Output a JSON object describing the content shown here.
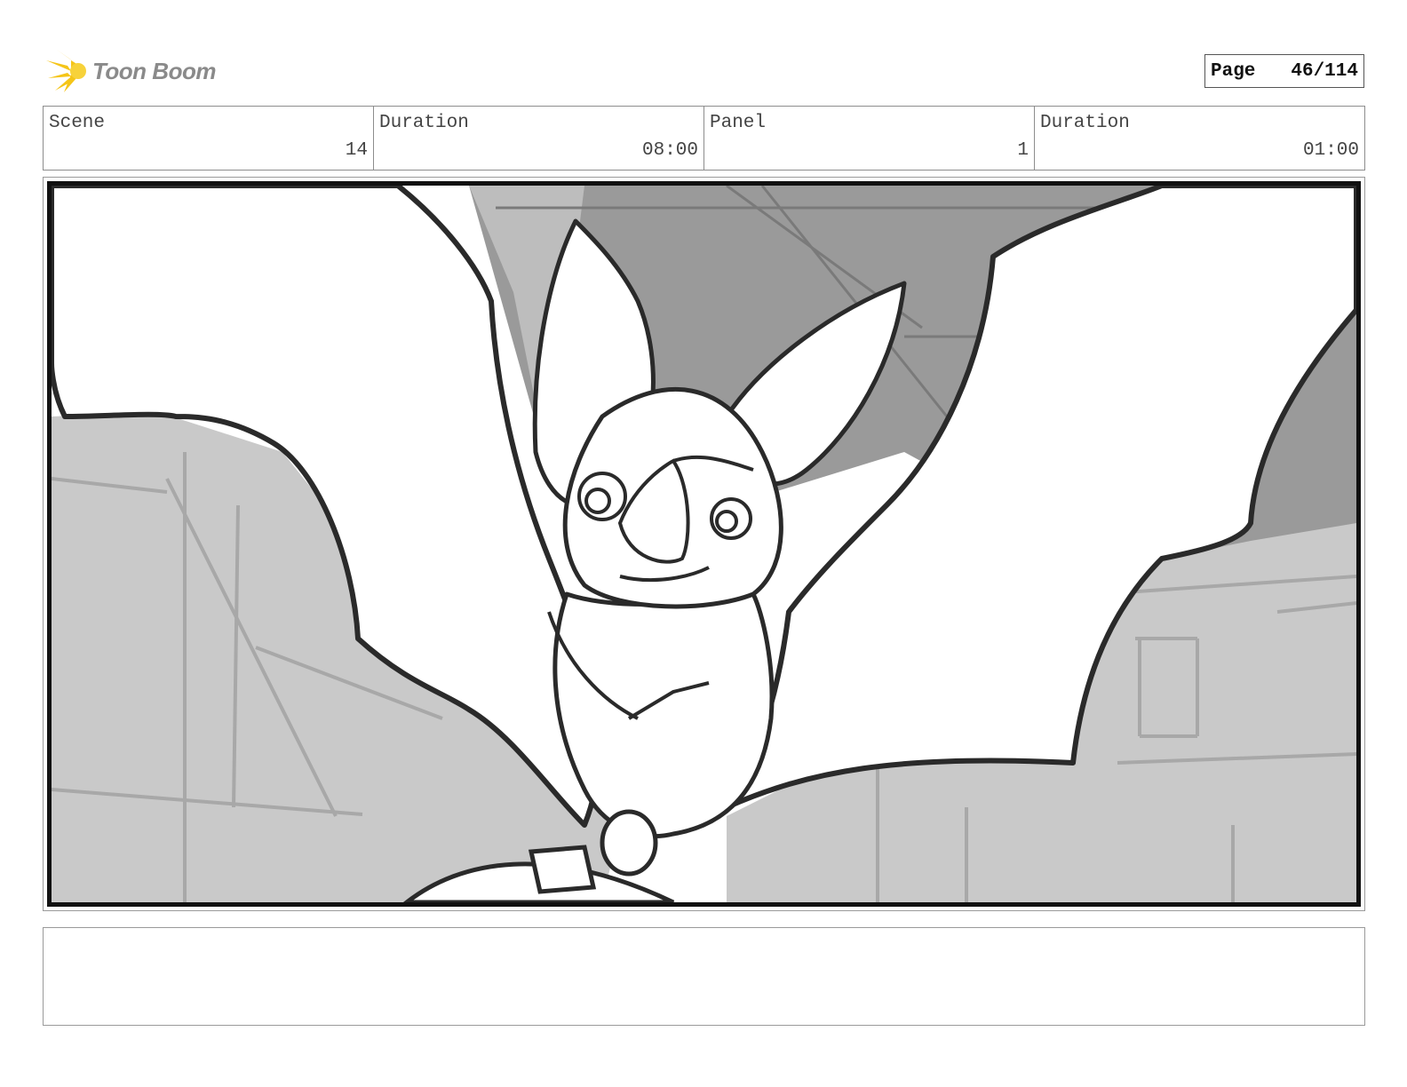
{
  "logo": {
    "text": "Toon Boom",
    "icon": "starburst-logo-icon",
    "color": "#f5c518"
  },
  "page": {
    "label": "Page",
    "value": "46/114"
  },
  "info": {
    "scene_label": "Scene",
    "scene_value": "14",
    "duration_label": "Duration",
    "duration_value": "08:00",
    "panel_label": "Panel",
    "panel_value": "1",
    "panel_duration_label": "Duration",
    "panel_duration_value": "01:00"
  },
  "panel": {
    "image": "bat-character-sketch",
    "colors": {
      "sky": "#9a9a9a",
      "ground": "#c9c9c9",
      "ink": "#2a2a2a"
    }
  },
  "notes": {
    "text": ""
  }
}
